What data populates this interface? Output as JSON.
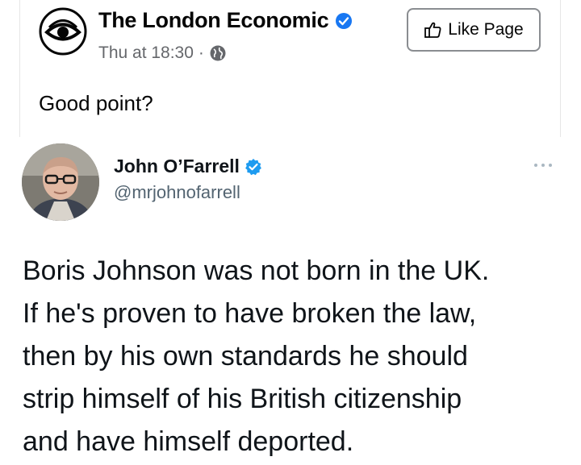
{
  "post": {
    "page_name": "The London Economic",
    "timestamp": "Thu at 18:30",
    "separator": "·",
    "like_button_label": "Like Page",
    "text": "Good point?",
    "icons": {
      "avatar": "eye-logo-icon",
      "verified": "verified-badge-icon",
      "audience": "globe-icon",
      "like": "thumbs-up-icon"
    },
    "colors": {
      "verified": "#1877f2",
      "meta_text": "#65676b"
    }
  },
  "tweet": {
    "author_name": "John O’Farrell",
    "handle": "@mrjohnofarrell",
    "body_lines": [
      "Boris Johnson was not born in the UK.",
      "If he's proven to have broken the law,",
      "then by his own standards he should",
      "strip himself of his British citizenship",
      "and have himself deported."
    ],
    "icons": {
      "avatar": "profile-photo",
      "verified": "verified-badge-icon",
      "more": "more-options-icon"
    },
    "colors": {
      "verified": "#1d9bf0",
      "handle_text": "#536471"
    }
  }
}
